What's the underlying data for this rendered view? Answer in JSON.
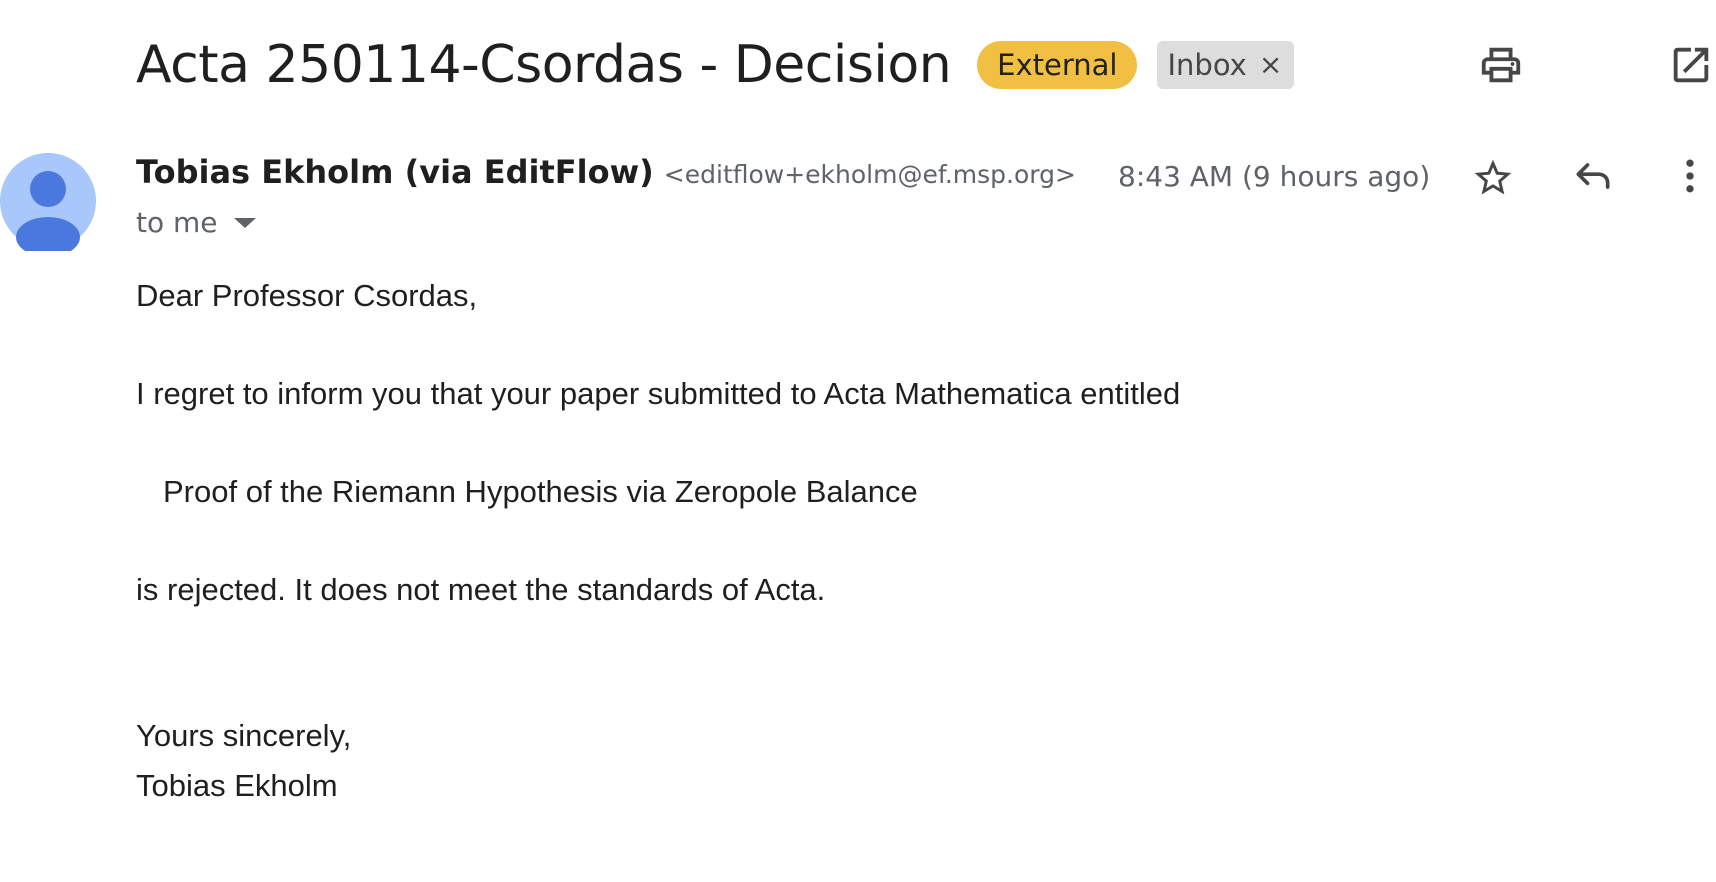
{
  "email": {
    "subject": "Acta 250114-Csordas - Decision",
    "labels": {
      "external": "External",
      "inbox": "Inbox",
      "inbox_remove": "×"
    },
    "sender": {
      "name": "Tobias Ekholm (via EditFlow)",
      "email": "<editflow+ekholm@ef.msp.org>"
    },
    "timestamp": "8:43 AM (9 hours ago)",
    "recipient": "to me",
    "body": {
      "greeting": "Dear Professor Csordas,",
      "line1": "I regret to inform you that your paper submitted to Acta Mathematica entitled",
      "paper_title": "Proof of the Riemann Hypothesis via Zeropole Balance",
      "line2": "is rejected. It does not meet the standards of Acta.",
      "closing": "Yours sincerely,",
      "signature": "Tobias Ekholm"
    }
  },
  "icons": {
    "print": "print-icon",
    "open_new_window": "open-in-new-window-icon",
    "star": "star-icon",
    "reply": "reply-icon",
    "more": "more-vertical-icon",
    "avatar": "avatar-icon",
    "recipient_details": "chevron-down-icon"
  },
  "colors": {
    "external_label": "#f1bf42",
    "inbox_label": "#dddddd",
    "avatar_background": "#a8c7fa",
    "avatar_figure": "#4a78de"
  }
}
